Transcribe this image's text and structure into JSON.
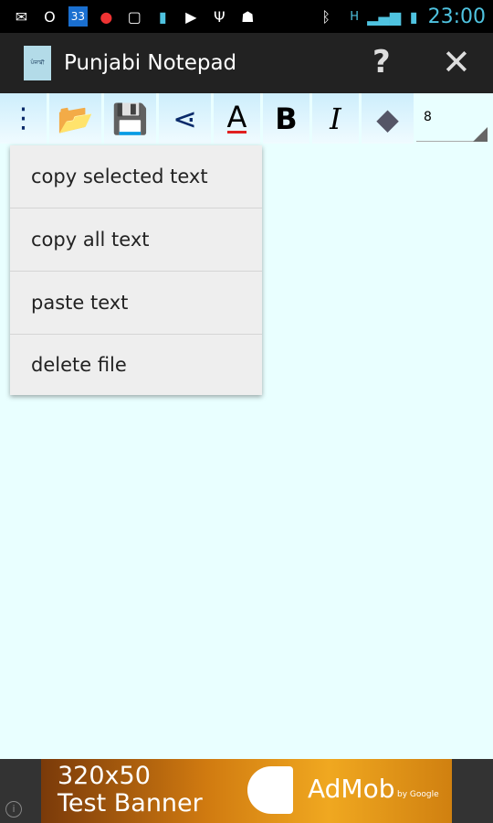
{
  "status_bar": {
    "time": "23:00",
    "calendar_badge": "33",
    "icons": [
      "mail-icon",
      "outlook-icon",
      "calendar-icon",
      "maps-icon",
      "screenshot-icon",
      "usb-battery-icon",
      "play-store-icon",
      "usb-icon",
      "android-debug-icon",
      "bluetooth-icon",
      "hspa-icon",
      "signal-icon",
      "battery-charging-icon"
    ]
  },
  "appbar": {
    "title": "Punjabi Notepad",
    "help": "?",
    "close": "✕"
  },
  "toolbar": {
    "font_size": "8",
    "bold": "B",
    "italic": "I",
    "text_color": "A",
    "colors": {
      "text_color_underline": "#e02020",
      "icon_blue": "#0a2a6a"
    }
  },
  "menu": {
    "items": [
      "copy selected text",
      "copy all text",
      "paste text",
      "delete file"
    ]
  },
  "ad": {
    "line1": "320x50",
    "line2": "Test Banner",
    "brand": "AdMob",
    "by": "by Google",
    "info": "i"
  }
}
